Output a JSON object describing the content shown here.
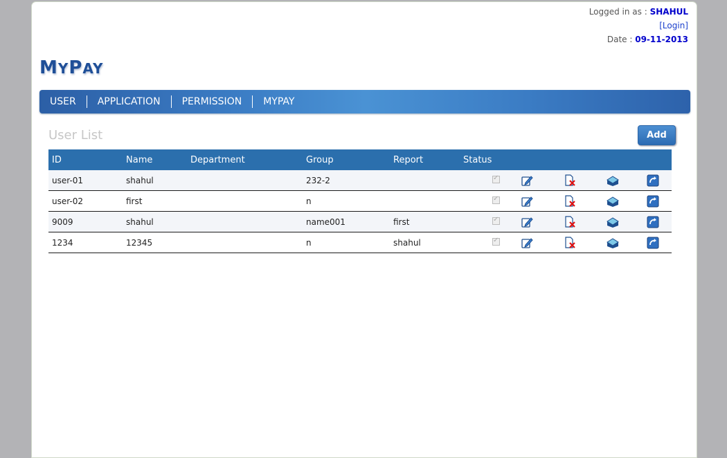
{
  "header": {
    "logged_in_prefix": "Logged in as : ",
    "username": "SHAHUL",
    "login_link": "[Login]",
    "date_prefix": "Date : ",
    "date": "09-11-2013"
  },
  "logo": {
    "m": "M",
    "y": "Y",
    "p": "P",
    "ay": "AY"
  },
  "nav": {
    "items": [
      {
        "label": "USER"
      },
      {
        "label": "APPLICATION"
      },
      {
        "label": "PERMISSION"
      },
      {
        "label": "MYPAY"
      }
    ]
  },
  "main": {
    "title": "User List",
    "add_label": "Add"
  },
  "table": {
    "headers": [
      "ID",
      "Name",
      "Department",
      "Group",
      "Report",
      "Status"
    ],
    "rows": [
      {
        "id": "user-01",
        "name": "shahul",
        "department": "",
        "group": "232-2",
        "report": "",
        "status": true
      },
      {
        "id": "user-02",
        "name": "first",
        "department": "",
        "group": "n",
        "report": "",
        "status": true
      },
      {
        "id": "9009",
        "name": "shahul",
        "department": "",
        "group": "name001",
        "report": "first",
        "status": true
      },
      {
        "id": "1234",
        "name": "12345",
        "department": "",
        "group": "n",
        "report": "shahul",
        "status": true
      }
    ],
    "row_icons": [
      "edit-icon",
      "delete-icon",
      "mail-icon",
      "refresh-icon"
    ]
  },
  "colors": {
    "accent": "#2b6fad",
    "logo": "#1f4f98",
    "username": "#0000cc"
  }
}
